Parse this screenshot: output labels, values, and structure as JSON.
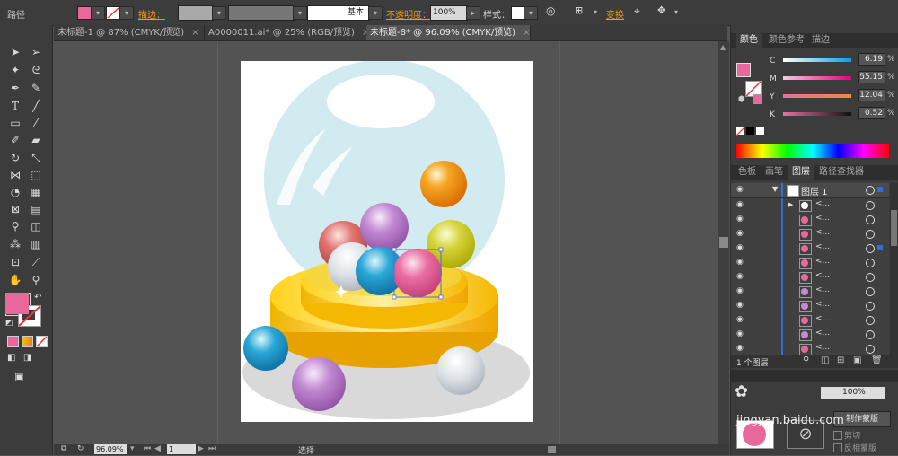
{
  "control_bar": {
    "object_label": "路径",
    "fill_color": "#e8689c",
    "stroke_label": "描边：",
    "stroke_style": "基本",
    "opacity_label": "不透明度：",
    "opacity_value": "100%",
    "style_label": "样式：",
    "transform_label": "变换"
  },
  "doc_tabs": [
    {
      "label": "未标题-1 @ 87% (CMYK/预览)",
      "active": false
    },
    {
      "label": "A0000011.ai* @ 25% (RGB/预览)",
      "active": false
    },
    {
      "label": "未标题-8* @ 96.09% (CMYK/预览)",
      "active": true
    }
  ],
  "tab_close": "×",
  "toolbox": {
    "fill_color": "#e8689c",
    "tools": [
      "selection",
      "direct-selection",
      "magic-wand",
      "lasso",
      "pen",
      "curvature",
      "type",
      "line",
      "rectangle",
      "paintbrush",
      "pencil",
      "eraser",
      "rotate",
      "scale",
      "width",
      "free-transform",
      "shape-builder",
      "perspective-grid",
      "mesh",
      "gradient",
      "eyedropper",
      "blend",
      "symbol-sprayer",
      "column-graph",
      "artboard",
      "slice",
      "hand",
      "zoom"
    ]
  },
  "color_panel": {
    "tabs": [
      "颜色",
      "颜色参考",
      "描边"
    ],
    "channels": [
      {
        "name": "C",
        "value": "6.19"
      },
      {
        "name": "M",
        "value": "55.15"
      },
      {
        "name": "Y",
        "value": "12.04"
      },
      {
        "name": "K",
        "value": "0.52"
      }
    ],
    "unit": "%"
  },
  "layers_panel": {
    "tabs": [
      "色板",
      "画笔",
      "图层",
      "路径查找器"
    ],
    "layer_name": "图层 1",
    "row_label": "<...",
    "sublayer_count": 12,
    "footer": "1 个图层"
  },
  "transparency_panel": {
    "opacity_value": "100%",
    "make_mask": "制作蒙版",
    "clip": "剪切",
    "invert_mask": "反相蒙版"
  },
  "status_bar": {
    "zoom": "96.09%",
    "page": "1",
    "mode": "选择"
  },
  "watermark": "jingyan.baidu.com"
}
